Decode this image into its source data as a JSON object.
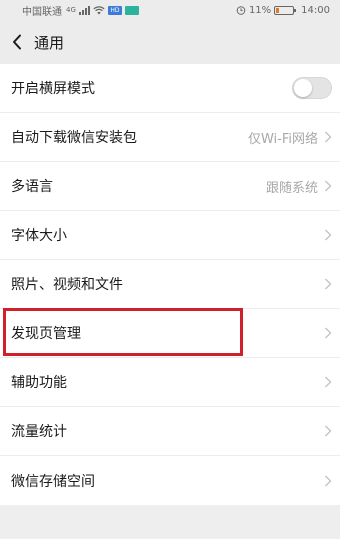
{
  "status_bar": {
    "carrier": "中国联通",
    "network_badge": "4G",
    "hd_badge": "HD",
    "battery": "11%",
    "time": "14:00",
    "icons": [
      "signal-icon",
      "wifi-icon",
      "notification-icon",
      "alarm-icon",
      "battery-icon"
    ]
  },
  "nav": {
    "title": "通用",
    "back_icon": "back-chevron-icon"
  },
  "settings": [
    {
      "label": "开启横屏模式",
      "control": "toggle",
      "toggle_on": false
    },
    {
      "label": "自动下载微信安装包",
      "value": "仅Wi-Fi网络",
      "control": "chevron"
    },
    {
      "label": "多语言",
      "value": "跟随系统",
      "control": "chevron"
    },
    {
      "label": "字体大小",
      "control": "chevron"
    },
    {
      "label": "照片、视频和文件",
      "control": "chevron"
    },
    {
      "label": "发现页管理",
      "control": "chevron",
      "highlighted": true
    },
    {
      "label": "辅助功能",
      "control": "chevron"
    },
    {
      "label": "流量统计",
      "control": "chevron"
    },
    {
      "label": "微信存储空间",
      "control": "chevron"
    }
  ],
  "colors": {
    "background": "#eeeeee",
    "highlight": "#d0202a",
    "value_text": "#a8a8a8"
  }
}
